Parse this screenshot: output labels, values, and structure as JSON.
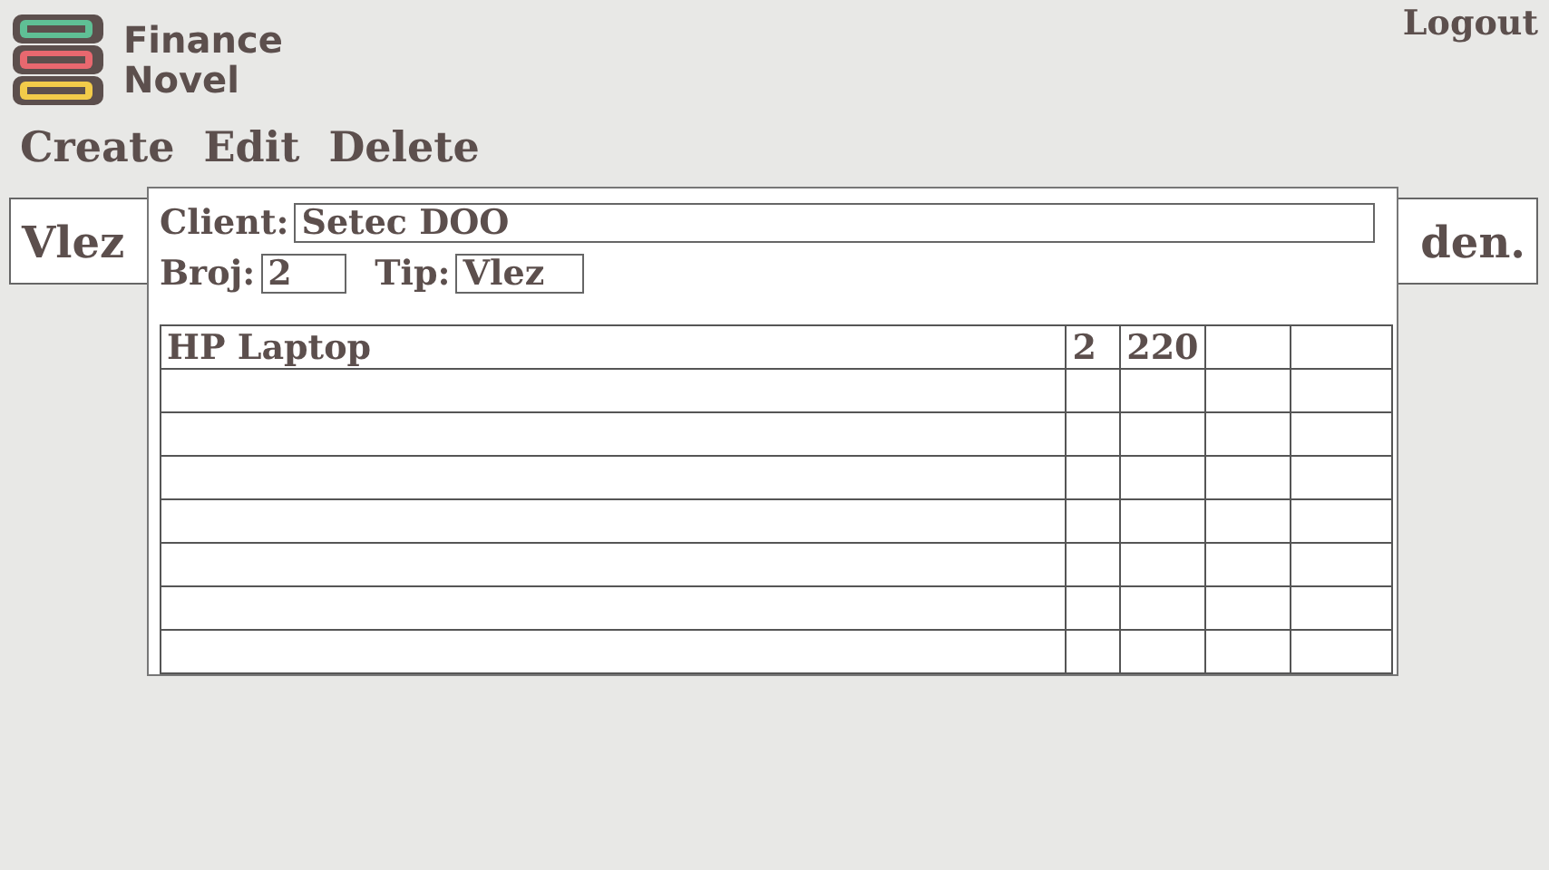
{
  "brand": {
    "line_1": "Finance",
    "line_2": "Novel"
  },
  "logout": "Logout",
  "menu": [
    "Create",
    "Edit",
    "Delete"
  ],
  "background_row": {
    "type": "Vlez",
    "amount": "den."
  },
  "dialog": {
    "client_label": "Client:",
    "client": "Setec DOO",
    "number_label": "Broj:",
    "number": "2",
    "type_label": "Tip:",
    "type": "Vlez",
    "rows": [
      {
        "item": "HP Laptop",
        "qty": "2",
        "price": "220"
      }
    ]
  }
}
